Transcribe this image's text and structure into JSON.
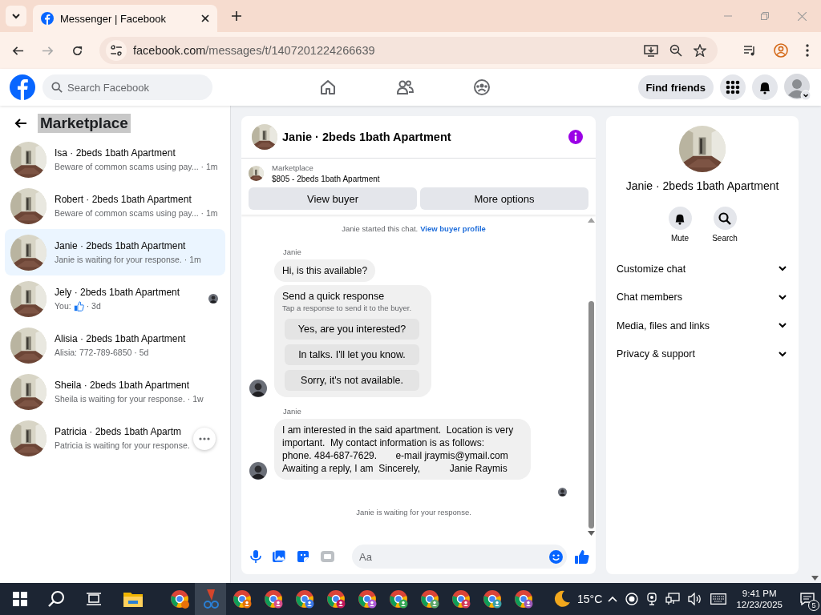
{
  "browser": {
    "tab_title": "Messenger | Facebook",
    "url_host": "facebook.com",
    "url_path": "/messages/t/1407201224266639"
  },
  "header": {
    "search_placeholder": "Search Facebook",
    "find_friends": "Find friends"
  },
  "sidebar": {
    "title": "Marketplace",
    "conversations": [
      {
        "name": "Isa · 2beds 1bath Apartment",
        "preview": "Beware of common scams using pay...",
        "time": "· 1m",
        "selected": false,
        "like": false,
        "seen": false,
        "more_button": false
      },
      {
        "name": "Robert · 2beds 1bath Apartment",
        "preview": "Beware of common scams using pay...",
        "time": "· 1m",
        "selected": false,
        "like": false,
        "seen": false,
        "more_button": false
      },
      {
        "name": "Janie · 2beds 1bath Apartment",
        "preview": "Janie is waiting for your response.",
        "time": "· 1m",
        "selected": true,
        "like": false,
        "seen": false,
        "more_button": false
      },
      {
        "name": "Jely · 2beds 1bath Apartment",
        "preview": "You:",
        "time": "· 3d",
        "selected": false,
        "like": true,
        "seen": true,
        "more_button": false
      },
      {
        "name": "Alisia · 2beds 1bath Apartment",
        "preview": "Alisia: 772-789-6850",
        "time": "· 5d",
        "selected": false,
        "like": false,
        "seen": false,
        "more_button": false
      },
      {
        "name": "Sheila · 2beds 1bath Apartment",
        "preview": "Sheila is waiting for your response.",
        "time": "· 1w",
        "selected": false,
        "like": false,
        "seen": false,
        "more_button": false
      },
      {
        "name": "Patricia · 2beds 1bath Apartm",
        "preview": "Patricia is waiting for your response.",
        "selected": false,
        "like": false,
        "seen": false,
        "more_button": true
      }
    ]
  },
  "chat": {
    "title": "Janie · 2beds 1bath Apartment",
    "listing": {
      "label": "Marketplace",
      "title": "$805 - 2beds 1bath Apartment"
    },
    "buttons": [
      "View buyer",
      "More options"
    ],
    "notice": {
      "text": "Janie started this chat.",
      "link": "View buyer profile"
    },
    "groups": [
      {
        "sender": "Janie",
        "items": [
          {
            "kind": "text",
            "text": "Hi, is this available?"
          },
          {
            "kind": "quick",
            "title": "Send a quick response",
            "subtitle": "Tap a response to send it to the buyer.",
            "options": [
              "Yes, are you interested?",
              "In talks. I'll let you know.",
              "Sorry, it's not available."
            ]
          }
        ]
      },
      {
        "sender": "Janie",
        "items": [
          {
            "kind": "text",
            "text": "I am interested in the said apartment.  Location is very important.  My contact information is as follows:\nphone. 484-687-7629.       e-mail jraymis@ymail.com\nAwaiting a reply, I am  Sincerely,           Janie Raymis"
          }
        ]
      }
    ],
    "status": "Janie is waiting for your response.",
    "composer_placeholder": "Aa"
  },
  "details": {
    "title": "Janie · 2beds 1bath Apartment",
    "actions": [
      {
        "kind": "mute",
        "label": "Mute"
      },
      {
        "kind": "search",
        "label": "Search"
      }
    ],
    "sections": [
      "Customize chat",
      "Chat members",
      "Media, files and links",
      "Privacy & support"
    ]
  },
  "taskbar": {
    "temperature": "15°C",
    "time": "9:41 PM",
    "date": "12/23/2025",
    "notifications": "5"
  }
}
